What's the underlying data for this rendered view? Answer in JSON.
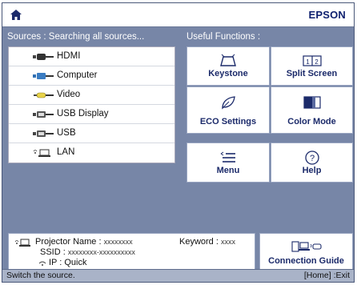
{
  "brand": "EPSON",
  "headings": {
    "sources": "Sources : Searching all sources...",
    "useful": "Useful Functions :"
  },
  "sources": [
    {
      "label": "HDMI",
      "icon": "hdmi-icon"
    },
    {
      "label": "Computer",
      "icon": "computer-port-icon"
    },
    {
      "label": "Video",
      "icon": "video-cable-icon"
    },
    {
      "label": "USB Display",
      "icon": "usb-display-icon"
    },
    {
      "label": "USB",
      "icon": "usb-icon"
    },
    {
      "label": "LAN",
      "icon": "lan-icon"
    }
  ],
  "functions": [
    {
      "label": "Keystone",
      "icon": "keystone-icon"
    },
    {
      "label": "Split Screen",
      "icon": "split-screen-icon"
    },
    {
      "label": "ECO Settings",
      "icon": "leaf-icon"
    },
    {
      "label": "Color Mode",
      "icon": "color-mode-icon"
    },
    {
      "label": "Menu",
      "icon": "menu-icon"
    },
    {
      "label": "Help",
      "icon": "help-icon"
    }
  ],
  "network": {
    "projector_name_label": "Projector Name :",
    "projector_name": "xxxxxxxx",
    "keyword_label": "Keyword :",
    "keyword": "xxxx",
    "ssid_label": "SSID :",
    "ssid": "xxxxxxxx-xxxxxxxxxx",
    "ip_label": "IP :",
    "ip": "Quick"
  },
  "connection_guide": {
    "label": "Connection Guide",
    "icon": "connection-guide-icon"
  },
  "status": {
    "left": "Switch the source.",
    "right": "[Home] :Exit"
  },
  "colors": {
    "background": "#7786a7",
    "brand": "#0d1f6e",
    "tile_text": "#1b2a6a"
  }
}
